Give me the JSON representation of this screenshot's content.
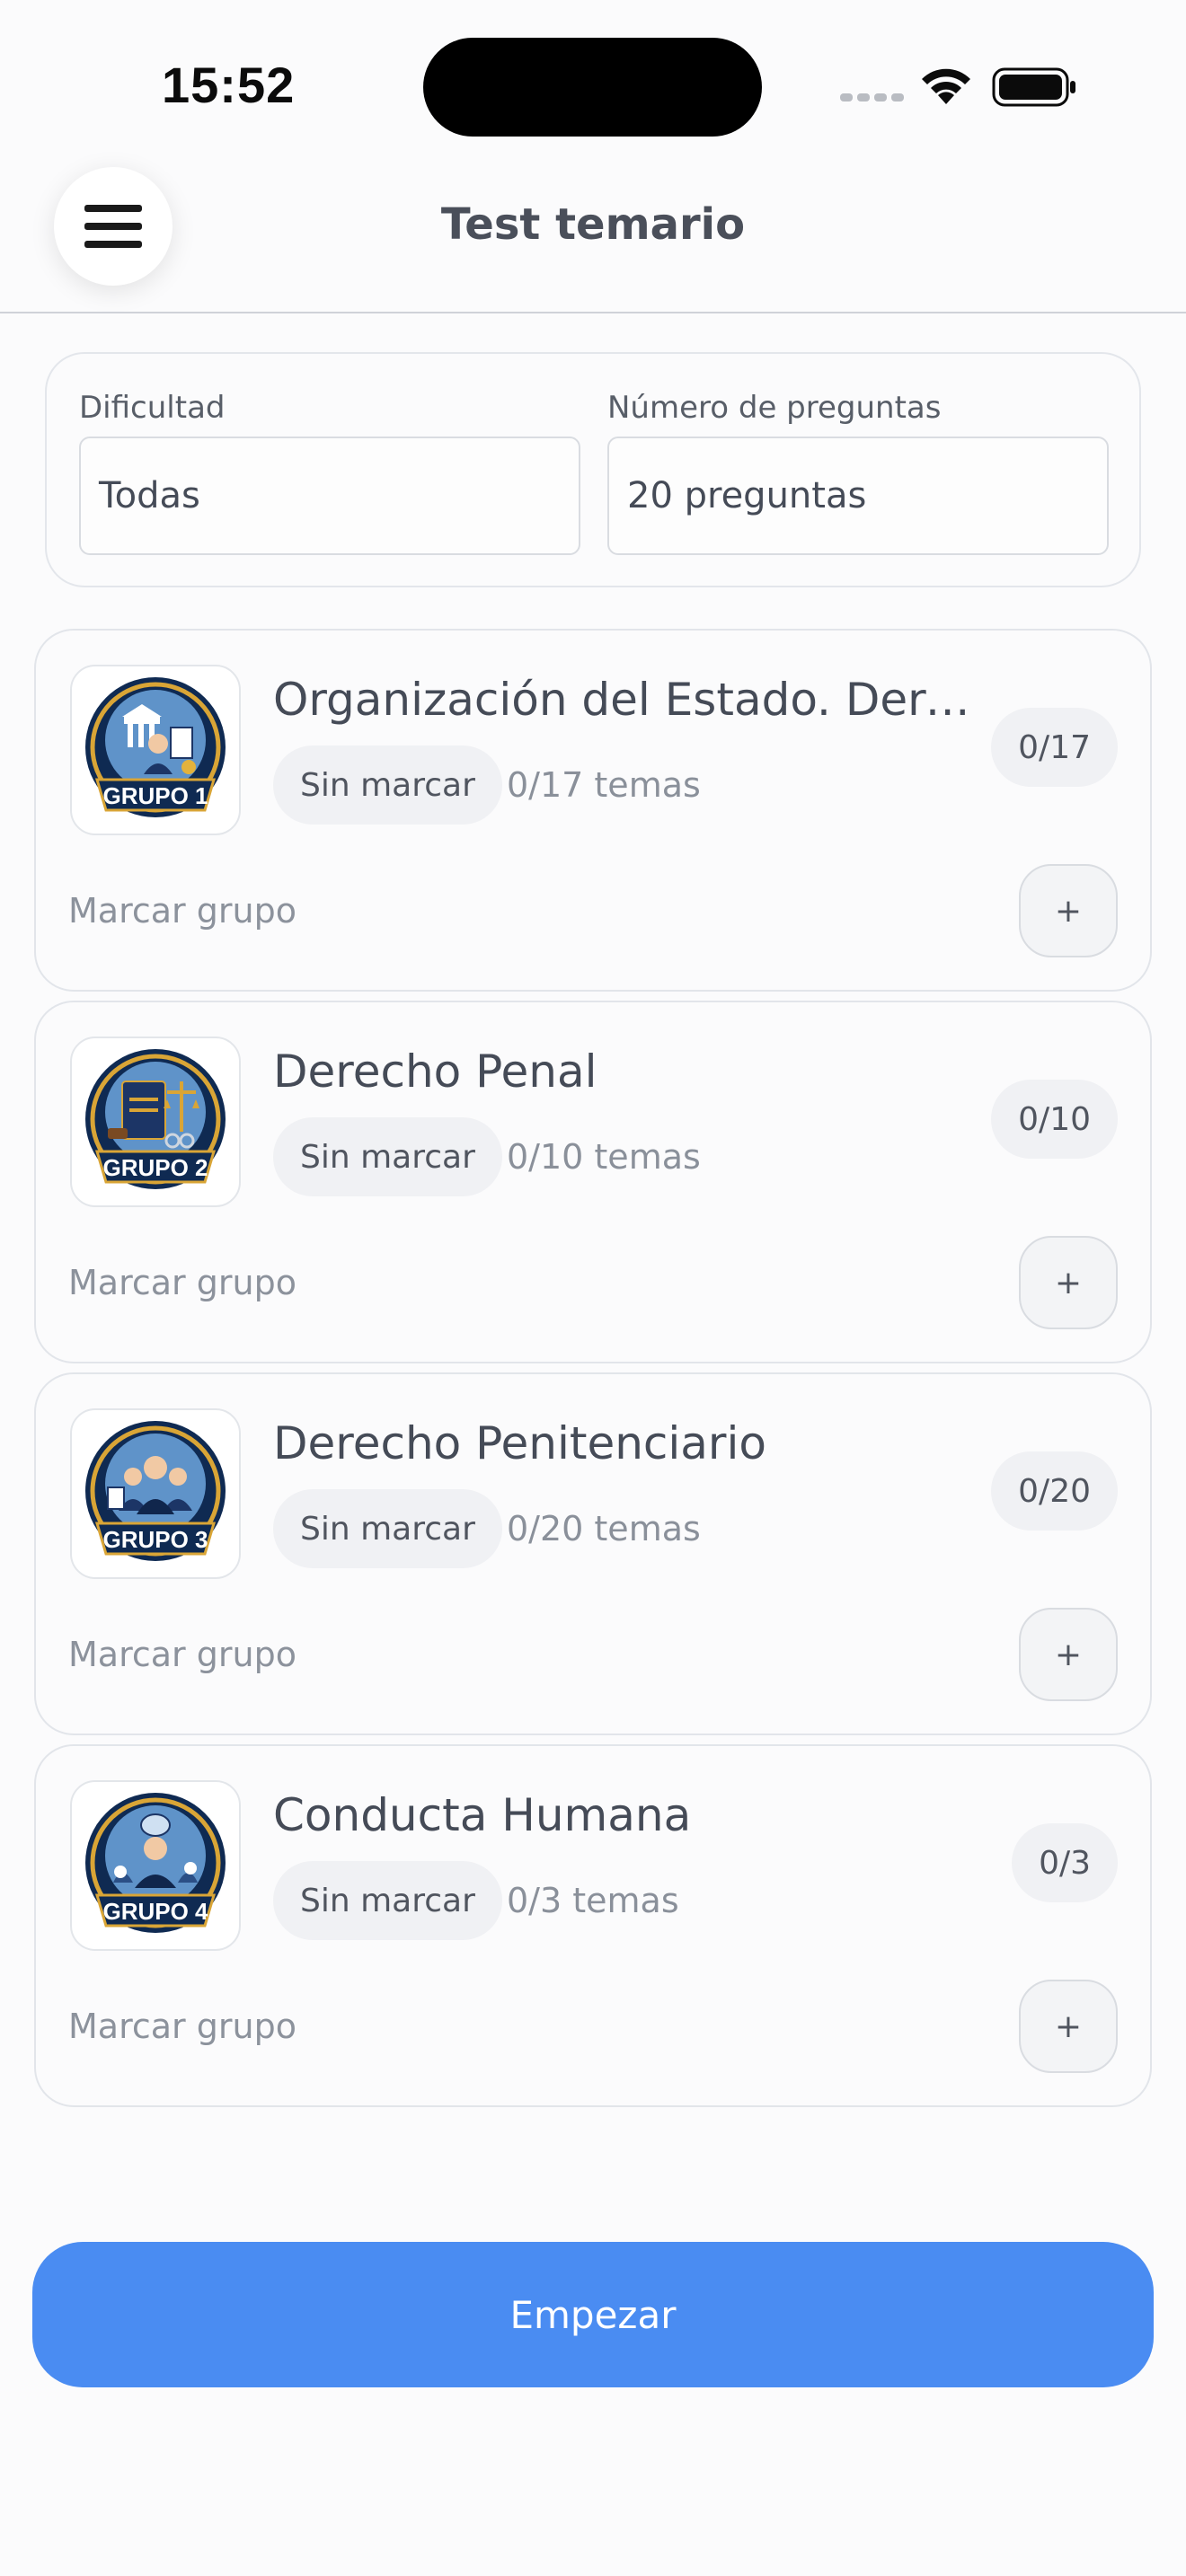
{
  "status_bar": {
    "time": "15:52"
  },
  "header": {
    "title": "Test temario"
  },
  "filters": {
    "difficulty_label": "Dificultad",
    "difficulty_value": "Todas",
    "questions_label": "Número de preguntas",
    "questions_value": "20 preguntas"
  },
  "groups": [
    {
      "badge_text": "GRUPO 1",
      "title": "Organización del Estado. Derech...",
      "status": "Sin marcar",
      "topics": "0/17 temas",
      "count": "0/17",
      "mark_label": "Marcar grupo",
      "plus": "+"
    },
    {
      "badge_text": "GRUPO 2",
      "title": "Derecho Penal",
      "status": "Sin marcar",
      "topics": "0/10 temas",
      "count": "0/10",
      "mark_label": "Marcar grupo",
      "plus": "+"
    },
    {
      "badge_text": "GRUPO 3",
      "title": "Derecho Penitenciario",
      "status": "Sin marcar",
      "topics": "0/20 temas",
      "count": "0/20",
      "mark_label": "Marcar grupo",
      "plus": "+"
    },
    {
      "badge_text": "GRUPO 4",
      "title": "Conducta Humana",
      "status": "Sin marcar",
      "topics": "0/3 temas",
      "count": "0/3",
      "mark_label": "Marcar grupo",
      "plus": "+"
    }
  ],
  "footer": {
    "start_label": "Empezar"
  },
  "colors": {
    "accent": "#4a8cf2",
    "badge_navy": "#0f2a52",
    "badge_gold": "#d9a536"
  }
}
